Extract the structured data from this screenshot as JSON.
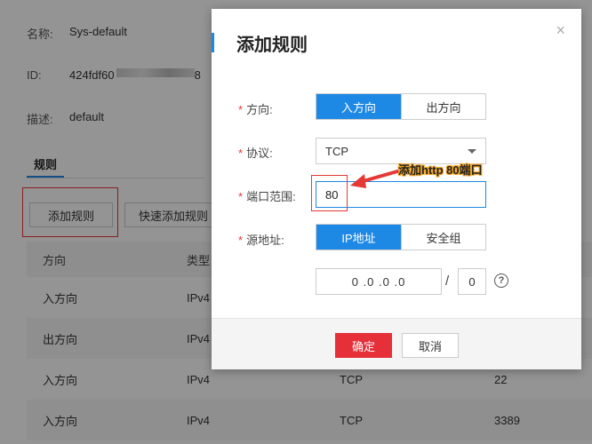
{
  "background": {
    "name_label": "名称:",
    "name_value": "Sys-default",
    "id_label": "ID:",
    "id_value_prefix": "424fdf60",
    "id_value_suffix": "8",
    "desc_label": "描述:",
    "desc_value": "default",
    "tab_rules": "规则",
    "add_rule_button": "添加规则",
    "quick_add_button": "快速添加规则",
    "table": {
      "headers": [
        "方向",
        "类型",
        "",
        "类型"
      ],
      "rows": [
        [
          "入方向",
          "IPv4",
          "",
          ""
        ],
        [
          "出方向",
          "IPv4",
          "",
          ""
        ],
        [
          "入方向",
          "IPv4",
          "TCP",
          "22"
        ],
        [
          "入方向",
          "IPv4",
          "TCP",
          "3389"
        ]
      ]
    }
  },
  "modal": {
    "title": "添加规则",
    "direction_label": "方向:",
    "direction_options": [
      "入方向",
      "出方向"
    ],
    "protocol_label": "协议:",
    "protocol_value": "TCP",
    "port_label": "端口范围:",
    "port_value": "80",
    "source_label": "源地址:",
    "source_options": [
      "IP地址",
      "安全组"
    ],
    "ip_value": "0 .0 .0 .0",
    "mask_value": "0",
    "required_mark": "*",
    "ok_label": "确定",
    "cancel_label": "取消",
    "close_glyph": "×",
    "help_glyph": "?"
  },
  "annotation": {
    "text": "添加http 80端口",
    "color": "#e53935",
    "highlight": "#f5a623"
  },
  "colors": {
    "primary": "#1e88e5",
    "danger": "#e5303a"
  }
}
